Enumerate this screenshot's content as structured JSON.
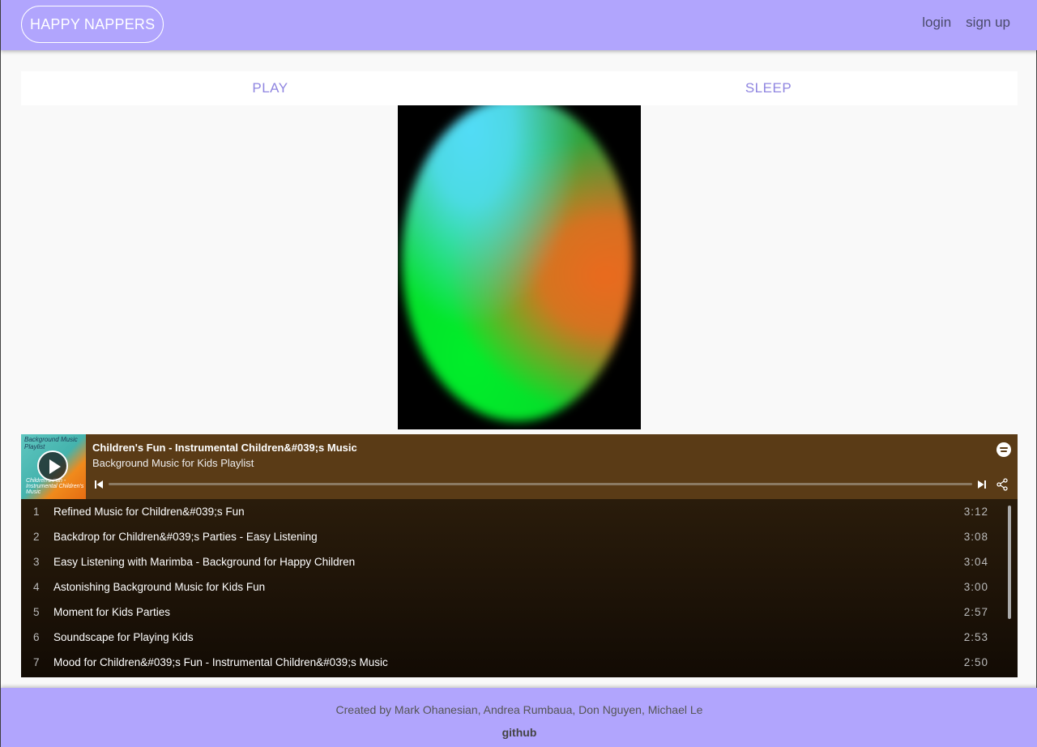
{
  "navbar": {
    "brand": "HAPPY NAPPERS",
    "links": [
      "login",
      "sign up"
    ]
  },
  "tabs": [
    "PLAY",
    "SLEEP"
  ],
  "player": {
    "cover_text_top": "Background Music Playlist",
    "cover_text_bottom": "Children's Fun - Instrumental Children's Music",
    "track_title": "Children's Fun - Instrumental Children&#039;s Music",
    "playlist_name": "Background Music for Kids Playlist",
    "tracks": [
      {
        "num": "1",
        "name": "Refined Music for Children&#039;s Fun",
        "duration": "3:12"
      },
      {
        "num": "2",
        "name": "Backdrop for Children&#039;s Parties - Easy Listening",
        "duration": "3:08"
      },
      {
        "num": "3",
        "name": "Easy Listening with Marimba - Background for Happy Children",
        "duration": "3:04"
      },
      {
        "num": "4",
        "name": "Astonishing Background Music for Kids Fun",
        "duration": "3:00"
      },
      {
        "num": "5",
        "name": "Moment for Kids Parties",
        "duration": "2:57"
      },
      {
        "num": "6",
        "name": "Soundscape for Playing Kids",
        "duration": "2:53"
      },
      {
        "num": "7",
        "name": "Mood for Children&#039;s Fun - Instrumental Children&#039;s Music",
        "duration": "2:50"
      }
    ]
  },
  "footer": {
    "credits": "Created by Mark Ohanesian, Andrea Rumbaua, Don Nguyen, Michael Le",
    "github": "github"
  },
  "colors": {
    "accent": "#b1a5fd",
    "tab_text": "#8f85e0",
    "player_header": "#5a3b16"
  }
}
